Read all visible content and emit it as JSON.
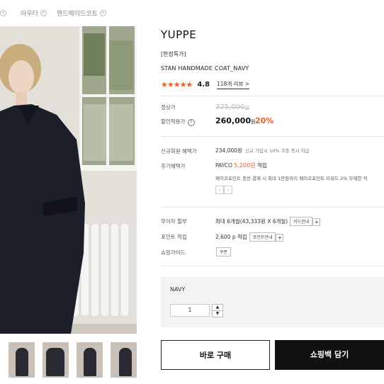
{
  "breadcrumb": [
    "아우터",
    "핸드메이드코트"
  ],
  "product": {
    "brand": "YUPPE",
    "tag": "[한정특가]",
    "name": "STAN HANDMADE COAT_NAVY",
    "stars": "★★★★★",
    "rating": "4.8",
    "reviews": "118개 리뷰 >"
  },
  "price": {
    "original_label": "정상가",
    "original": "325,000",
    "original_unit": "원",
    "sale_label": "할인적용가",
    "sale": "260,000",
    "sale_unit": "원",
    "discount": "20%"
  },
  "benefits": {
    "member_label": "신규회원 혜택가",
    "member_price": "234,000원",
    "member_note": "신규 가입시 10% 쿠폰 즉시 지급",
    "extra_label": "추가혜택가",
    "payco_prefix": "PAYCO",
    "payco_amount": "5,200원",
    "payco_suffix": "적립",
    "payco_note": "페이코포인트 충전 결제 시 최대 1만원까지 페이코포인트 리워드 2% 무제한 적"
  },
  "info": {
    "installment_label": "무이자 할부",
    "installment_value": "최대 6개월(43,333원 X 6개월)",
    "installment_btn": "카드안내",
    "point_label": "포인트 적립",
    "point_value": "2,600 p",
    "point_suffix": "적립",
    "point_btn": "포인트안내",
    "guide_label": "쇼핑가이드",
    "guide_btn": "쿠폰"
  },
  "option": {
    "name": "NAVY",
    "quantity": "1"
  },
  "actions": {
    "buy": "바로 구매",
    "cart": "쇼핑백 담기"
  },
  "colors": {
    "accent": "#e0622a",
    "dark": "#111111"
  }
}
